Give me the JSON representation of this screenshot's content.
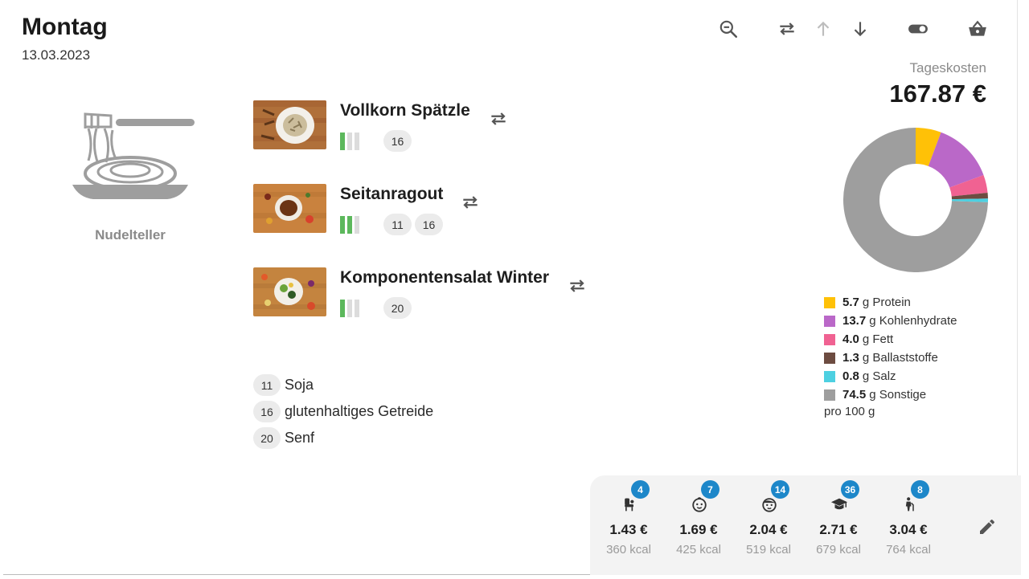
{
  "day": {
    "title": "Montag",
    "date": "13.03.2023"
  },
  "toolbar": [
    {
      "name": "zoom-out-icon",
      "interactable": true
    },
    {
      "name": "swap-icon",
      "interactable": true
    },
    {
      "name": "arrow-up-icon",
      "interactable": true
    },
    {
      "name": "arrow-down-icon",
      "interactable": true
    },
    {
      "name": "toggle-icon",
      "interactable": true
    },
    {
      "name": "basket-icon",
      "interactable": true
    }
  ],
  "dish": {
    "icon": "noodle-plate-icon",
    "name": "Nudelteller"
  },
  "meals": [
    {
      "title": "Vollkorn Spätzle",
      "rating": 1,
      "rating_max": 3,
      "allergens": [
        "16"
      ],
      "image": "spaetzle-photo"
    },
    {
      "title": "Seitanragout",
      "rating": 2,
      "rating_max": 3,
      "allergens": [
        "11",
        "16"
      ],
      "image": "seitan-photo"
    },
    {
      "title": "Komponentensalat Winter",
      "rating": 1,
      "rating_max": 3,
      "allergens": [
        "20"
      ],
      "image": "salad-photo"
    }
  ],
  "allergen_legend": [
    {
      "code": "11",
      "label": "Soja"
    },
    {
      "code": "16",
      "label": "glutenhaltiges Getreide"
    },
    {
      "code": "20",
      "label": "Senf"
    }
  ],
  "cost": {
    "label": "Tageskosten",
    "value": "167.87 €"
  },
  "nutrition": {
    "items": [
      {
        "amount": "5.7",
        "unit": "g",
        "label": "Protein",
        "value": 5.7,
        "color": "#ffc107"
      },
      {
        "amount": "13.7",
        "unit": "g",
        "label": "Kohlenhydrate",
        "value": 13.7,
        "color": "#ba68c8"
      },
      {
        "amount": "4.0",
        "unit": "g",
        "label": "Fett",
        "value": 4.0,
        "color": "#f06292"
      },
      {
        "amount": "1.3",
        "unit": "g",
        "label": "Ballaststoffe",
        "value": 1.3,
        "color": "#6d4c41"
      },
      {
        "amount": "0.8",
        "unit": "g",
        "label": "Salz",
        "value": 0.8,
        "color": "#4dd0e1"
      },
      {
        "amount": "74.5",
        "unit": "g",
        "label": "Sonstige",
        "value": 74.5,
        "color": "#9e9e9e"
      }
    ],
    "footnote": "pro 100 g"
  },
  "prices": [
    {
      "icon": "baby-chair-icon",
      "badge": "4",
      "price": "1.43 €",
      "kcal": "360 kcal"
    },
    {
      "icon": "toddler-face-icon",
      "badge": "7",
      "price": "1.69 €",
      "kcal": "425 kcal"
    },
    {
      "icon": "child-face-icon",
      "badge": "14",
      "price": "2.04 €",
      "kcal": "519 kcal"
    },
    {
      "icon": "graduation-cap-icon",
      "badge": "36",
      "price": "2.71 €",
      "kcal": "679 kcal"
    },
    {
      "icon": "senior-icon",
      "badge": "8",
      "price": "3.04 €",
      "kcal": "764 kcal"
    }
  ],
  "edit": {
    "icon": "pencil-icon"
  }
}
